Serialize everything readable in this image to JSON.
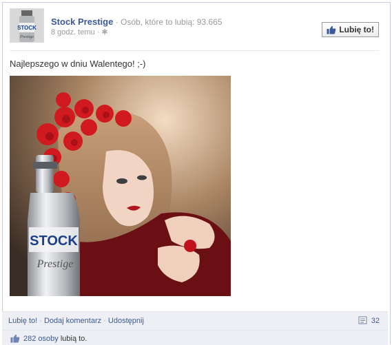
{
  "post": {
    "page_name": "Stock Prestige",
    "separator": " · ",
    "likes_label": "Osób, które to lubią: 93.665",
    "timestamp": "8 godz. temu",
    "meta_sep": " · ",
    "like_page_label": "Lubię to!",
    "message": "Najlepszego w dniu Walentego! ;-)",
    "avatar_brand": "STOCK",
    "avatar_sub": "Prestige",
    "bottle_brand": "STOCK",
    "bottle_sub": "Prestige"
  },
  "actions": {
    "like": "Lubię to!",
    "comment": "Dodaj komentarz",
    "share": "Udostępnij",
    "sep": " · ",
    "comment_count": "32"
  },
  "likes_row": {
    "count_link": "282 osoby",
    "suffix": " lubią to."
  },
  "colors": {
    "link": "#3b5998",
    "bar": "#edeff4"
  }
}
